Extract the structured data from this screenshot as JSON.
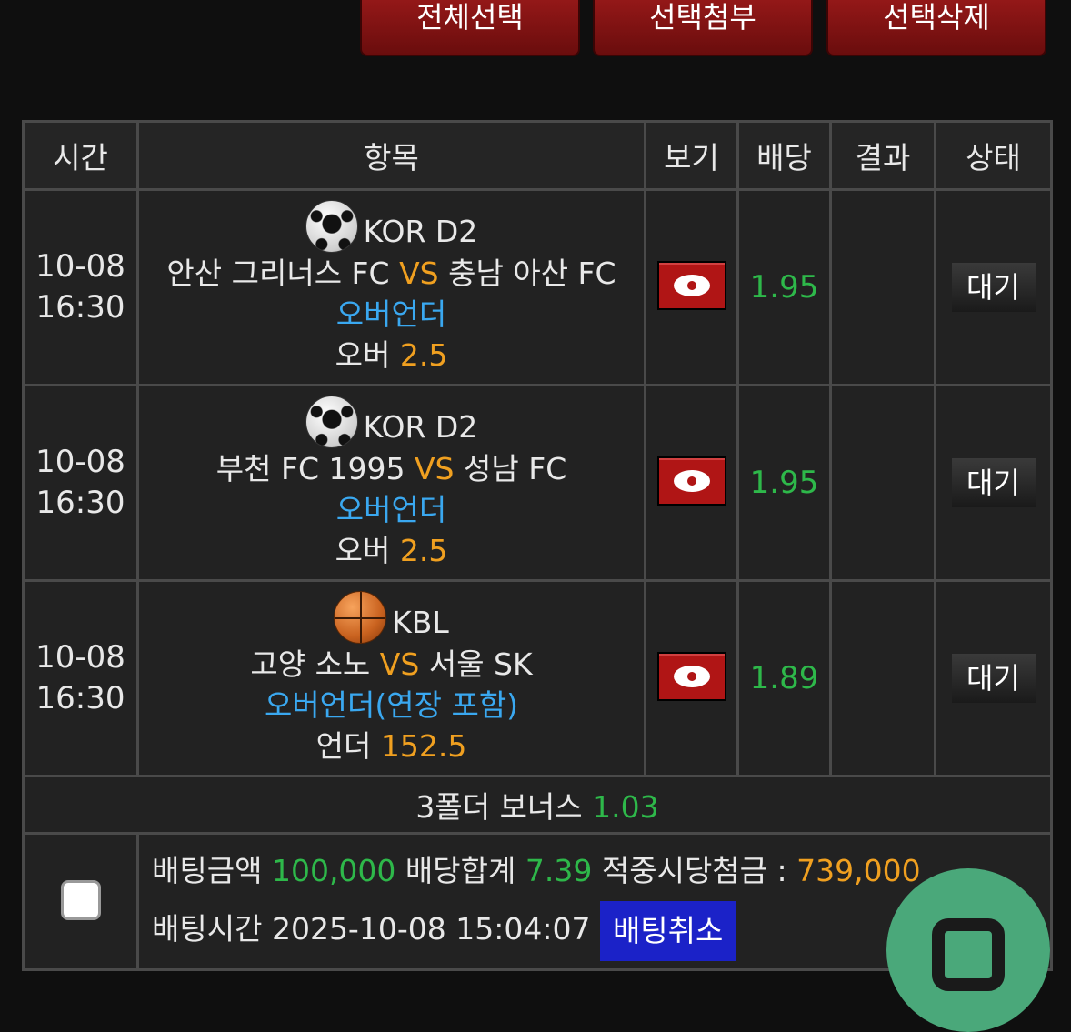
{
  "toolbar": {
    "select_all": "전체선택",
    "select_attach": "선택첨부",
    "select_delete": "선택삭제"
  },
  "table": {
    "headers": [
      "시간",
      "항목",
      "보기",
      "배당",
      "결과",
      "상태"
    ],
    "rows": [
      {
        "date": "10-08",
        "time": "16:30",
        "sport_icon": "soccer-ball-icon",
        "league": "KOR D2",
        "home": "안산 그리너스 FC",
        "vs": "VS",
        "away": "충남 아산 FC",
        "market": "오버언더",
        "pick": "오버",
        "line": "2.5",
        "odds": "1.95",
        "result": "",
        "status": "대기"
      },
      {
        "date": "10-08",
        "time": "16:30",
        "sport_icon": "soccer-ball-icon",
        "league": "KOR D2",
        "home": "부천 FC 1995",
        "vs": "VS",
        "away": "성남 FC",
        "market": "오버언더",
        "pick": "오버",
        "line": "2.5",
        "odds": "1.95",
        "result": "",
        "status": "대기"
      },
      {
        "date": "10-08",
        "time": "16:30",
        "sport_icon": "basketball-icon",
        "league": "KBL",
        "home": "고양 소노",
        "vs": "VS",
        "away": "서울 SK",
        "market": "오버언더(연장 포함)",
        "pick": "언더",
        "line": "152.5",
        "odds": "1.89",
        "result": "",
        "status": "대기"
      }
    ]
  },
  "bonus": {
    "label": "3폴더 보너스",
    "value": "1.03"
  },
  "summary": {
    "bet_amount_label": "배팅금액",
    "bet_amount": "100,000",
    "odds_total_label": "배당합계",
    "odds_total": "7.39",
    "payout_label": "적중시당첨금 :",
    "payout": "739,000",
    "bet_time_label": "배팅시간",
    "bet_time": "2025-10-08 15:04:07",
    "cancel_label": "배팅취소"
  },
  "colors": {
    "accent_red": "#b01515",
    "odds_green": "#2eb84a",
    "highlight_orange": "#f0a020",
    "market_blue": "#3aa8f0",
    "cancel_blue": "#1b22c8",
    "fab_green": "#4aa87a"
  }
}
